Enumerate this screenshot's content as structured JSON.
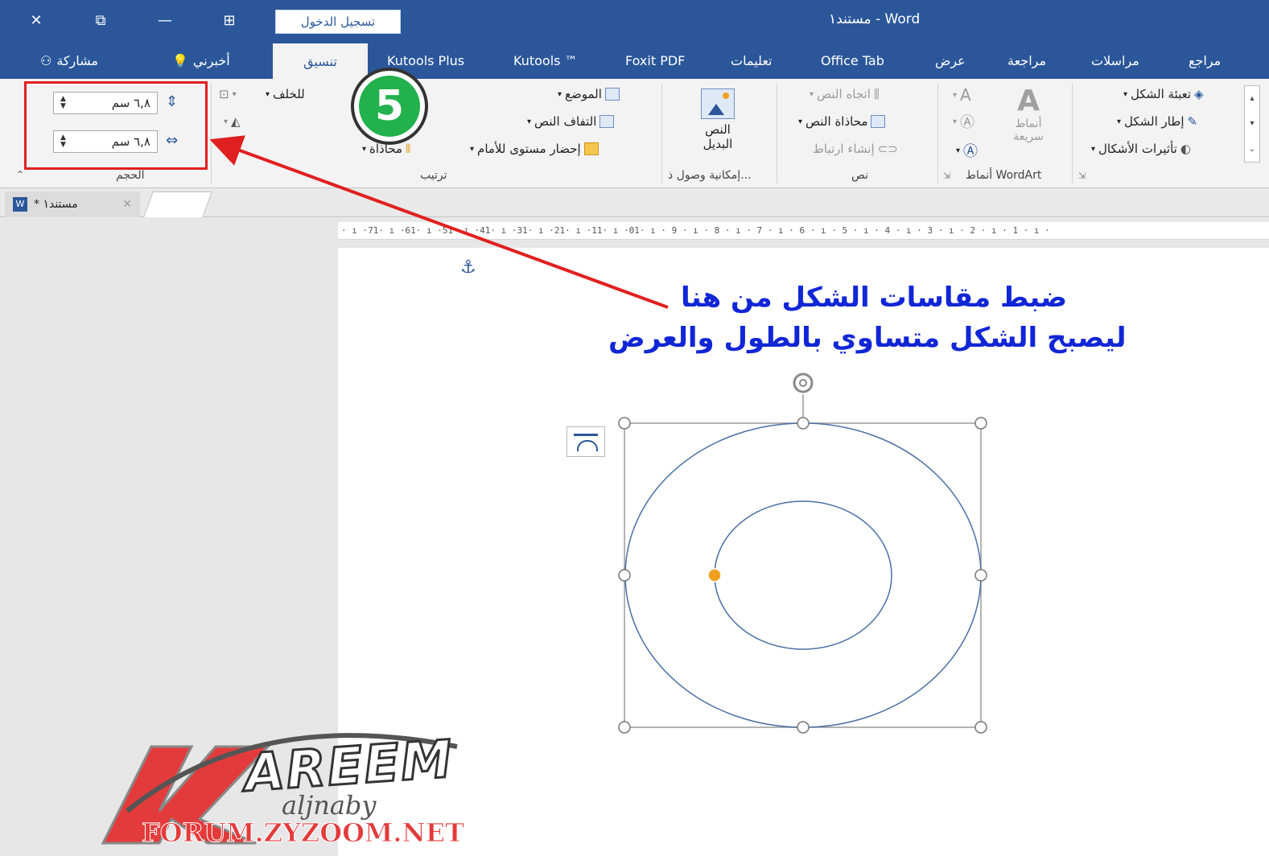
{
  "titlebar": {
    "signin_label": "تسجيل الدخول",
    "doc_title": "مستند١ - Word",
    "close_glyph": "✕",
    "restore_glyph": "⧉",
    "minimize_glyph": "—",
    "ribbon_display_glyph": "⊞"
  },
  "tabs": {
    "share": "مشاركة",
    "tell_me": "أخبرني",
    "format": "تنسيق",
    "kutools_plus": "Kutools Plus",
    "kutools": "Kutools ™",
    "foxit": "Foxit PDF",
    "help": "تعليمات",
    "office_tab": "Office Tab",
    "view": "عرض",
    "review": "مراجعة",
    "mailings": "مراسلات",
    "references": "مراجع"
  },
  "ribbon": {
    "size": {
      "height_value": "٦,٨ سم",
      "width_value": "٦,٨ سم",
      "group_label": "الحجم"
    },
    "arrange": {
      "send_backward": "للخلف",
      "position": "الموضع",
      "wrap_text": "التفاف النص",
      "bring_forward": "إحضار مستوى للأمام",
      "align": "محاذاة",
      "group_label": "ترتيب"
    },
    "accessibility": {
      "alt_text_line1": "النص",
      "alt_text_line2": "البديل",
      "group_label": "إمكانية وصول ذ..."
    },
    "text": {
      "text_direction": "اتجاه النص",
      "align_text": "محاذاة النص",
      "create_link": "إنشاء ارتباط",
      "group_label": "نص"
    },
    "wordart": {
      "quick_styles_line1": "أنماط",
      "quick_styles_line2": "سريعة",
      "group_label": "أنماط WordArt"
    },
    "shape_styles": {
      "shape_fill": "تعبئة الشكل",
      "shape_outline": "إطار الشكل",
      "shape_effects": "تأثيرات الأشكال"
    },
    "badge_number": "5"
  },
  "doctabs": {
    "doc_tab_label": "* مستند١"
  },
  "ruler": {
    "text": "· ı ·71· ı ·61· ı ·51· ı ·41· ı ·31· ı ·21· ı ·11· ı ·01· ı · 9 · ı · 8 · ı · 7 · ı · 6 · ı · 5 · ı · 4 · ı · 3 · ı · 2 · ı · 1 · ı ·"
  },
  "document": {
    "instruction_line1": "ضبط مقاسات الشكل من هنا",
    "instruction_line2": "ليصبح الشكل متساوي بالطول والعرض",
    "anchor_glyph": "⚓"
  },
  "watermark": {
    "brand": "AREEM",
    "initial": "K",
    "script": "aljnaby",
    "url": "FORUM.ZYZOOM.NET"
  },
  "colors": {
    "accent": "#2b579a",
    "instruction_text": "#1126d6",
    "highlight_box": "#e02020",
    "badge_green": "#22b14c",
    "shape_stroke": "#4a6fa5",
    "adjust_handle": "#f0a020"
  }
}
